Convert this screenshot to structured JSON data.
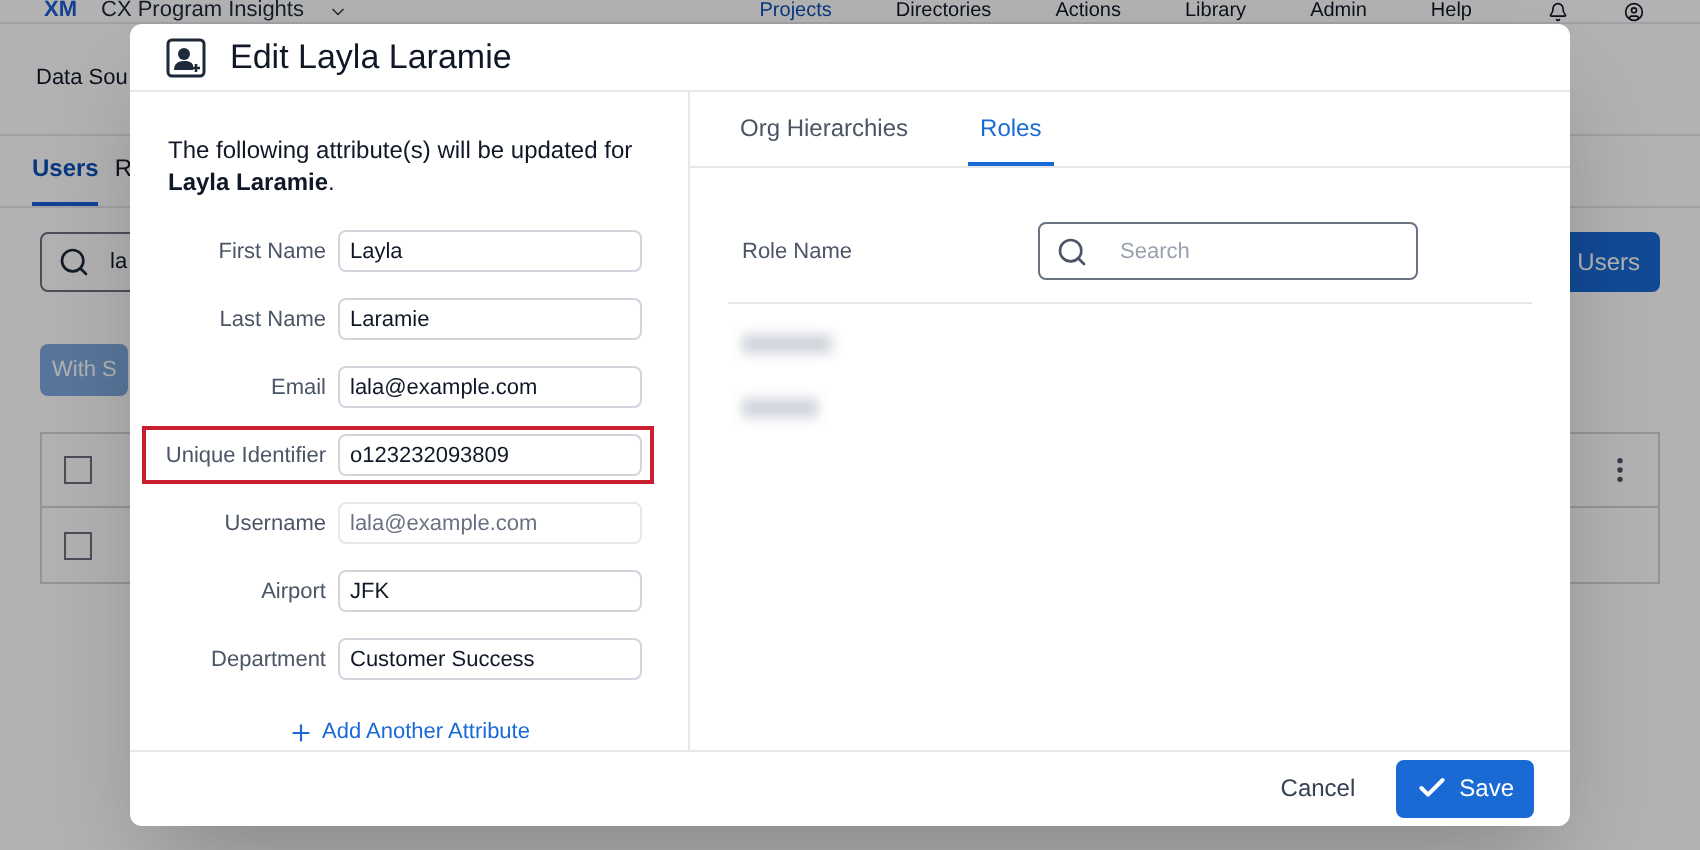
{
  "app": {
    "logo": "XM",
    "title": "CX Program Insights",
    "nav": [
      "Projects",
      "Directories",
      "Actions",
      "Library",
      "Admin",
      "Help"
    ],
    "subnav": "Data Sou",
    "tabs": [
      {
        "label": "Users",
        "selected": true
      },
      {
        "label": "R",
        "selected": false
      }
    ],
    "search_value": "la",
    "action_button": "With S",
    "add_button": "Users",
    "rows": [
      {
        "checked": false
      },
      {
        "checked": false
      }
    ]
  },
  "dialog": {
    "title": "Edit Layla Laramie",
    "intro": "The following attribute(s) will be updated for **Layla Laramie**.",
    "fields": [
      {
        "label": "First Name",
        "value": "Layla",
        "disabled": false,
        "highlighted": false
      },
      {
        "label": "Last Name",
        "value": "Laramie",
        "disabled": false,
        "highlighted": false
      },
      {
        "label": "Email",
        "value": "lala@example.com",
        "disabled": false,
        "highlighted": false
      },
      {
        "label": "Unique Identifier",
        "value": "o123232093809",
        "disabled": false,
        "highlighted": true
      },
      {
        "label": "Username",
        "value": "lala@example.com",
        "disabled": true,
        "highlighted": false
      },
      {
        "label": "Airport",
        "value": "JFK",
        "disabled": false,
        "highlighted": false
      },
      {
        "label": "Department",
        "value": "Customer Success",
        "disabled": false,
        "highlighted": false
      }
    ],
    "add_link": "Add Another Attribute",
    "tabs": [
      {
        "label": "Org Hierarchies",
        "selected": false
      },
      {
        "label": "Roles",
        "selected": true
      }
    ],
    "role_label": "Role Name",
    "search": {
      "placeholder": "Search"
    },
    "cancel": "Cancel",
    "save": "Save"
  }
}
